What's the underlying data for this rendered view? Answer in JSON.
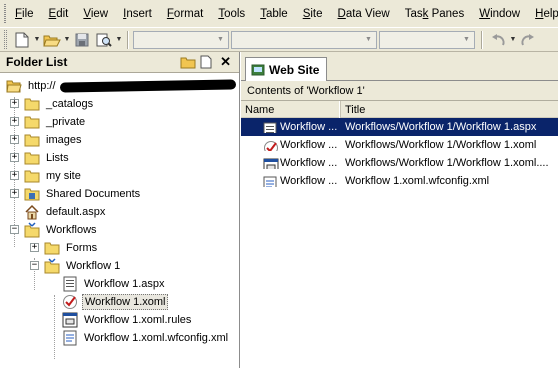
{
  "menu": {
    "items": [
      {
        "label": "File",
        "u": "F",
        "rest": "ile"
      },
      {
        "label": "Edit",
        "u": "E",
        "rest": "dit"
      },
      {
        "label": "View",
        "u": "V",
        "rest": "iew"
      },
      {
        "label": "Insert",
        "u": "I",
        "rest": "nsert"
      },
      {
        "label": "Format",
        "u": "F",
        "rest": "ormat"
      },
      {
        "label": "Tools",
        "u": "T",
        "rest": "ools"
      },
      {
        "label": "Table",
        "u": "T",
        "rest": "able"
      },
      {
        "label": "Site",
        "u": "S",
        "rest": "ite"
      },
      {
        "label": "Data View",
        "u": "D",
        "rest": "ata View"
      },
      {
        "label": "Task Panes",
        "pre": "Tas",
        "u": "k",
        "rest": " Panes"
      },
      {
        "label": "Window",
        "u": "W",
        "rest": "indow"
      },
      {
        "label": "Help",
        "u": "H",
        "rest": "elp"
      }
    ]
  },
  "folder_list": {
    "title": "Folder List",
    "root": "http://",
    "items": {
      "catalogs": "_catalogs",
      "private": "_private",
      "images": "images",
      "lists": "Lists",
      "mysite": "my site",
      "shared": "Shared Documents",
      "default": "default.aspx",
      "workflows": "Workflows",
      "forms": "Forms",
      "workflow1": "Workflow 1",
      "wf_aspx": "Workflow 1.aspx",
      "wf_xoml": "Workflow 1.xoml",
      "wf_rules": "Workflow 1.xoml.rules",
      "wf_config": "Workflow 1.xoml.wfconfig.xml"
    }
  },
  "web_site": {
    "tab_label": "Web Site",
    "contents_label": "Contents of 'Workflow 1'",
    "columns": {
      "name": "Name",
      "title": "Title"
    },
    "rows": [
      {
        "name": "Workflow ...",
        "title": "Workflows/Workflow 1/Workflow 1.aspx",
        "icon": "aspx-page-icon",
        "selected": true
      },
      {
        "name": "Workflow ...",
        "title": "Workflows/Workflow 1/Workflow 1.xoml",
        "icon": "xoml-workflow-icon",
        "selected": false
      },
      {
        "name": "Workflow ...",
        "title": "Workflows/Workflow 1/Workflow 1.xoml....",
        "icon": "rules-file-icon",
        "selected": false
      },
      {
        "name": "Workflow ...",
        "title": "Workflow 1.xoml.wfconfig.xml",
        "icon": "xml-config-icon",
        "selected": false
      }
    ]
  },
  "colors": {
    "chrome": "#ece9d8",
    "selection": "#0a246a",
    "folder": "#f5d96b"
  }
}
